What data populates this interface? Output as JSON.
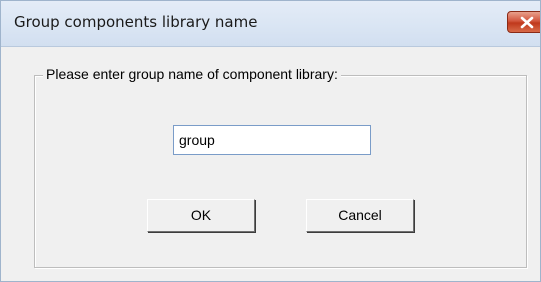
{
  "window": {
    "title": "Group components library name"
  },
  "group_box": {
    "legend": "Please enter group name of component library:"
  },
  "name_input": {
    "value": "group"
  },
  "buttons": {
    "ok_label": "OK",
    "cancel_label": "Cancel"
  },
  "icons": {
    "close": "close-icon"
  },
  "colors": {
    "close_button": "#c8452a",
    "title_bar": "#dbe6f4",
    "dialog_background": "#f0f0f0"
  }
}
